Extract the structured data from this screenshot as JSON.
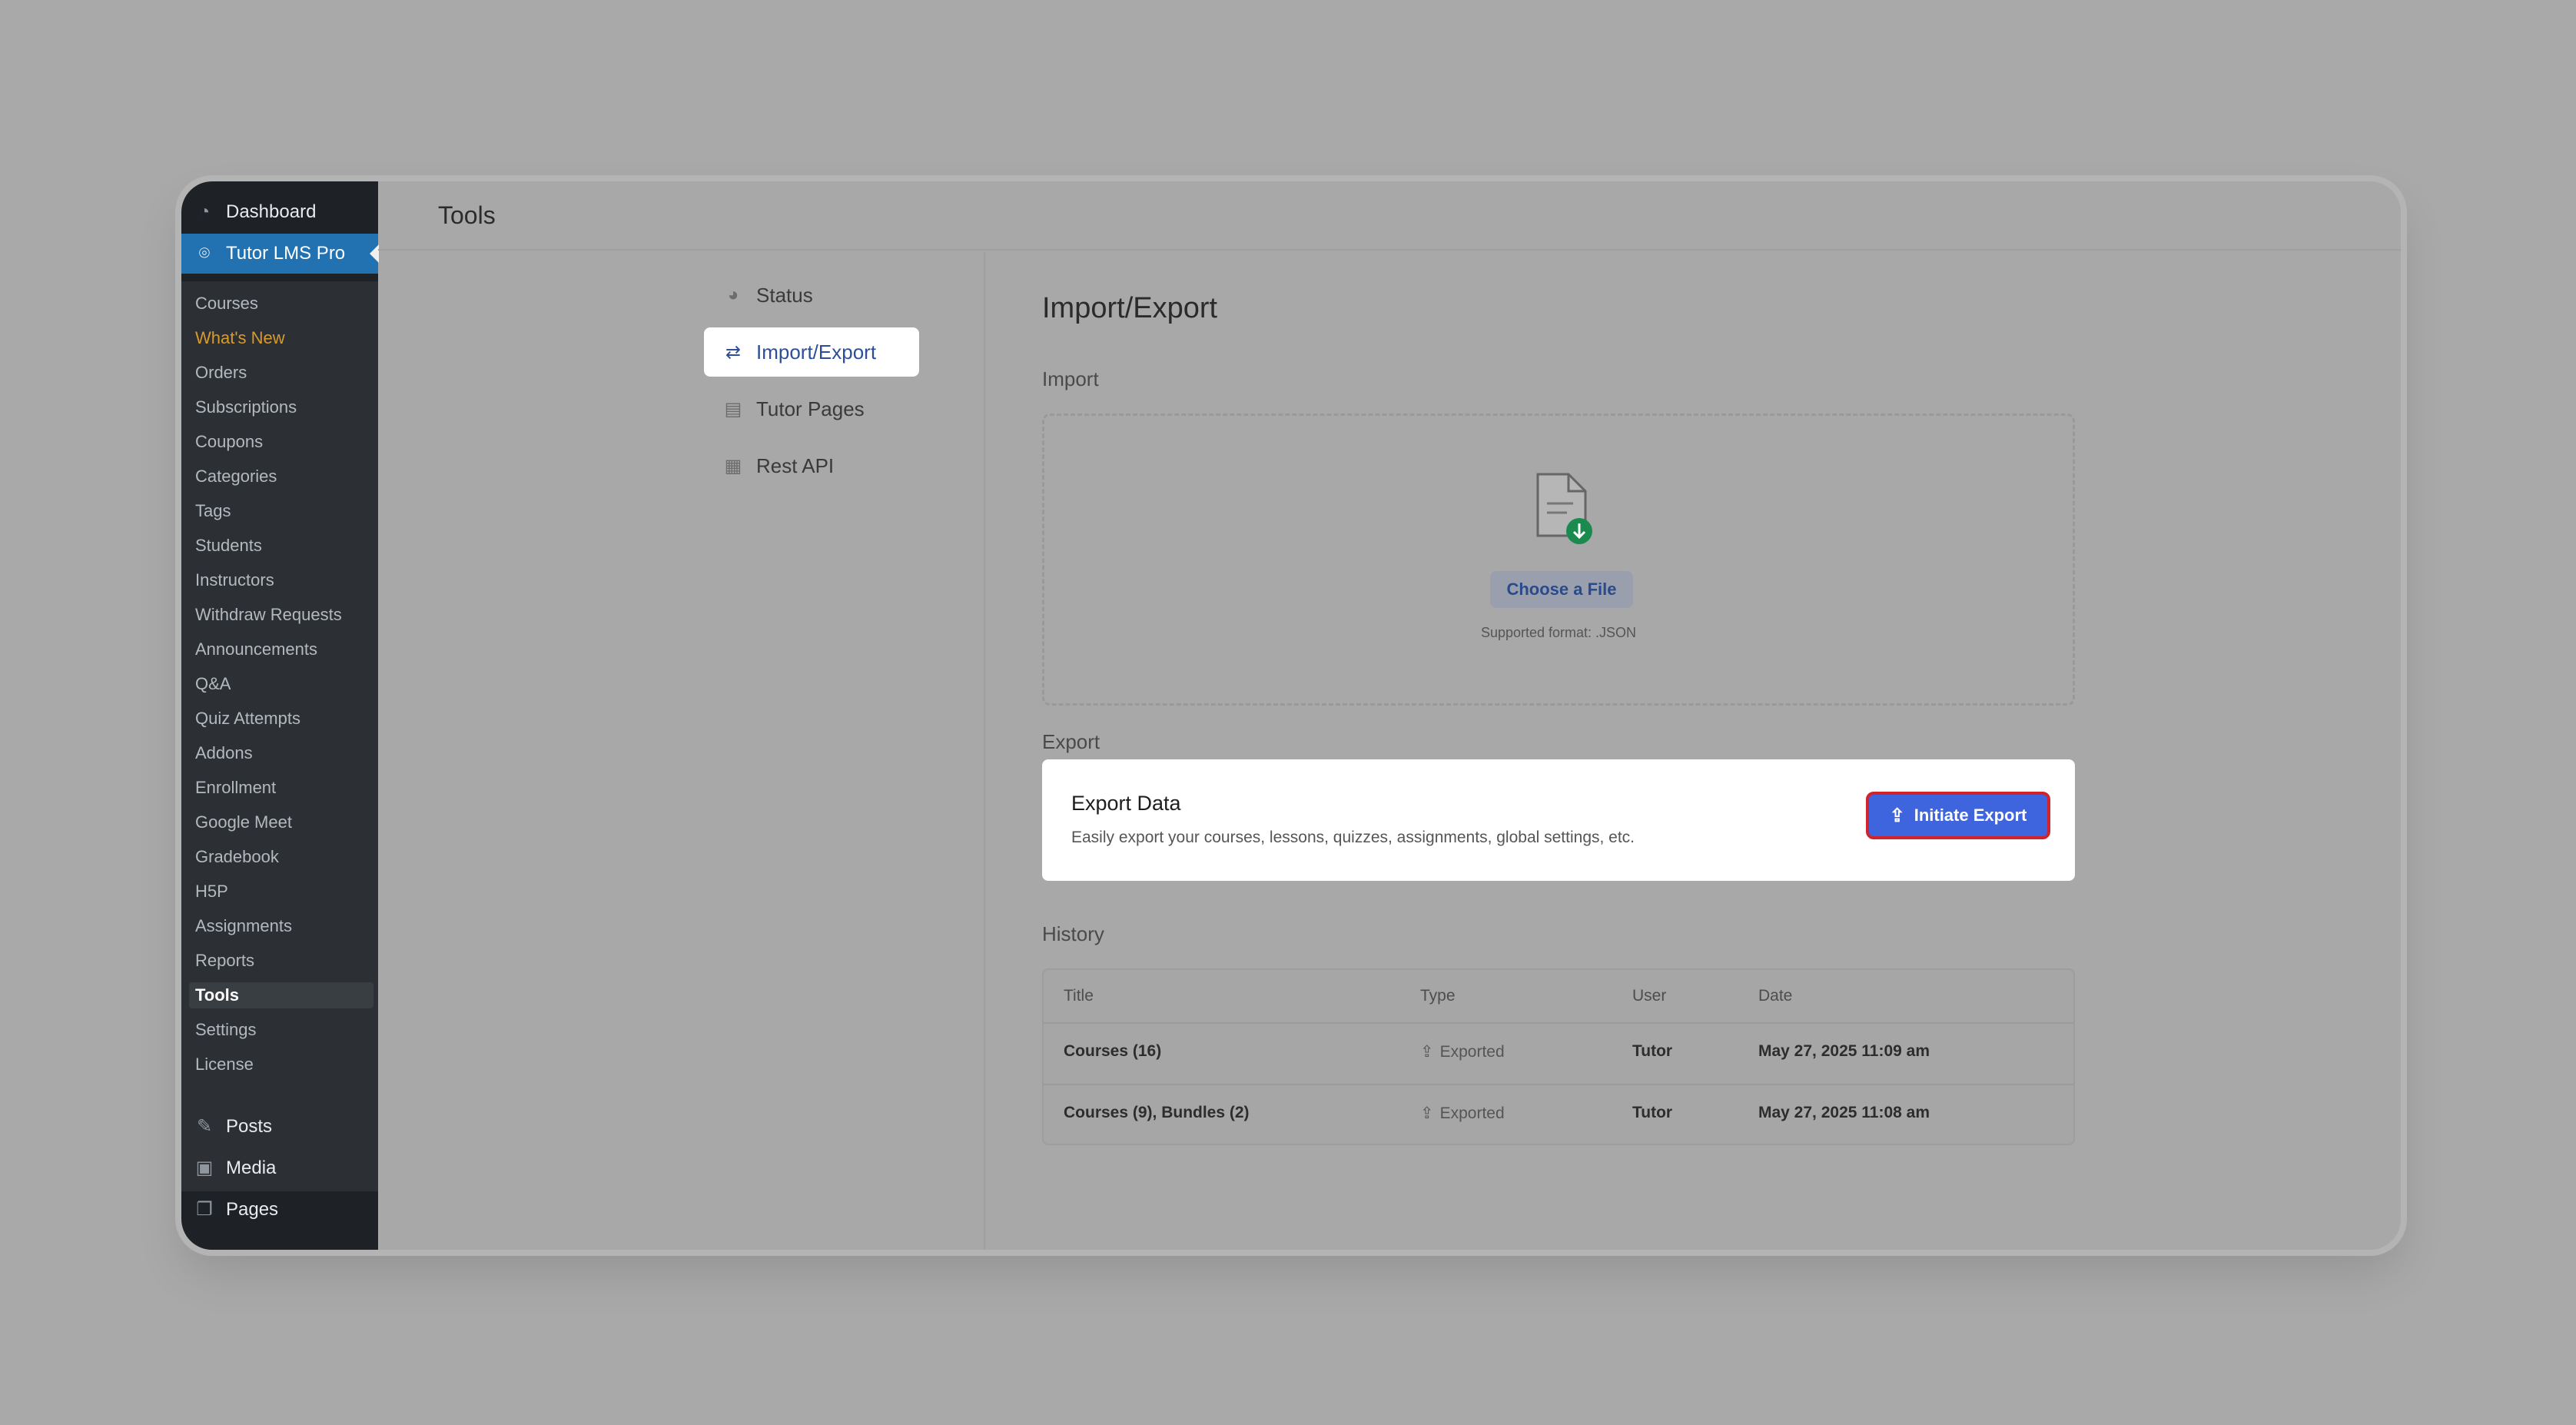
{
  "sidebar": {
    "top_items": [
      {
        "label": "Dashboard",
        "icon": "dashboard-icon"
      },
      {
        "label": "Tutor LMS Pro",
        "icon": "tutor-icon"
      }
    ],
    "submenu": [
      "Courses",
      "What's New",
      "Orders",
      "Subscriptions",
      "Coupons",
      "Categories",
      "Tags",
      "Students",
      "Instructors",
      "Withdraw Requests",
      "Announcements",
      "Q&A",
      "Quiz Attempts",
      "Addons",
      "Enrollment",
      "Google Meet",
      "Gradebook",
      "H5P",
      "Assignments",
      "Reports",
      "Tools",
      "Settings",
      "License"
    ],
    "bottom_items": [
      {
        "label": "Posts",
        "icon": "pin-icon"
      },
      {
        "label": "Media",
        "icon": "media-icon"
      },
      {
        "label": "Pages",
        "icon": "pages-icon"
      }
    ],
    "highlight_color": "#d89a2c",
    "active_color": "#2271b1"
  },
  "header": {
    "title": "Tools"
  },
  "tools_nav": [
    {
      "label": "Status",
      "icon": "status-icon"
    },
    {
      "label": "Import/Export",
      "icon": "import-export-icon"
    },
    {
      "label": "Tutor Pages",
      "icon": "pages-icon"
    },
    {
      "label": "Rest API",
      "icon": "api-icon"
    }
  ],
  "content": {
    "title": "Import/Export",
    "import": {
      "label": "Import",
      "choose_button": "Choose a File",
      "supported_format": "Supported format: .JSON"
    },
    "export": {
      "label": "Export",
      "card_title": "Export Data",
      "card_description": "Easily export your courses, lessons, quizzes, assignments, global settings, etc.",
      "button_label": "Initiate Export",
      "button_color": "#3e64de"
    },
    "history": {
      "label": "History",
      "columns": [
        "Title",
        "Type",
        "User",
        "Date"
      ],
      "rows": [
        {
          "title": "Courses (16)",
          "type": "Exported",
          "user": "Tutor",
          "date": "May 27, 2025 11:09 am"
        },
        {
          "title": "Courses (9), Bundles (2)",
          "type": "Exported",
          "user": "Tutor",
          "date": "May 27, 2025 11:08 am"
        }
      ]
    }
  }
}
